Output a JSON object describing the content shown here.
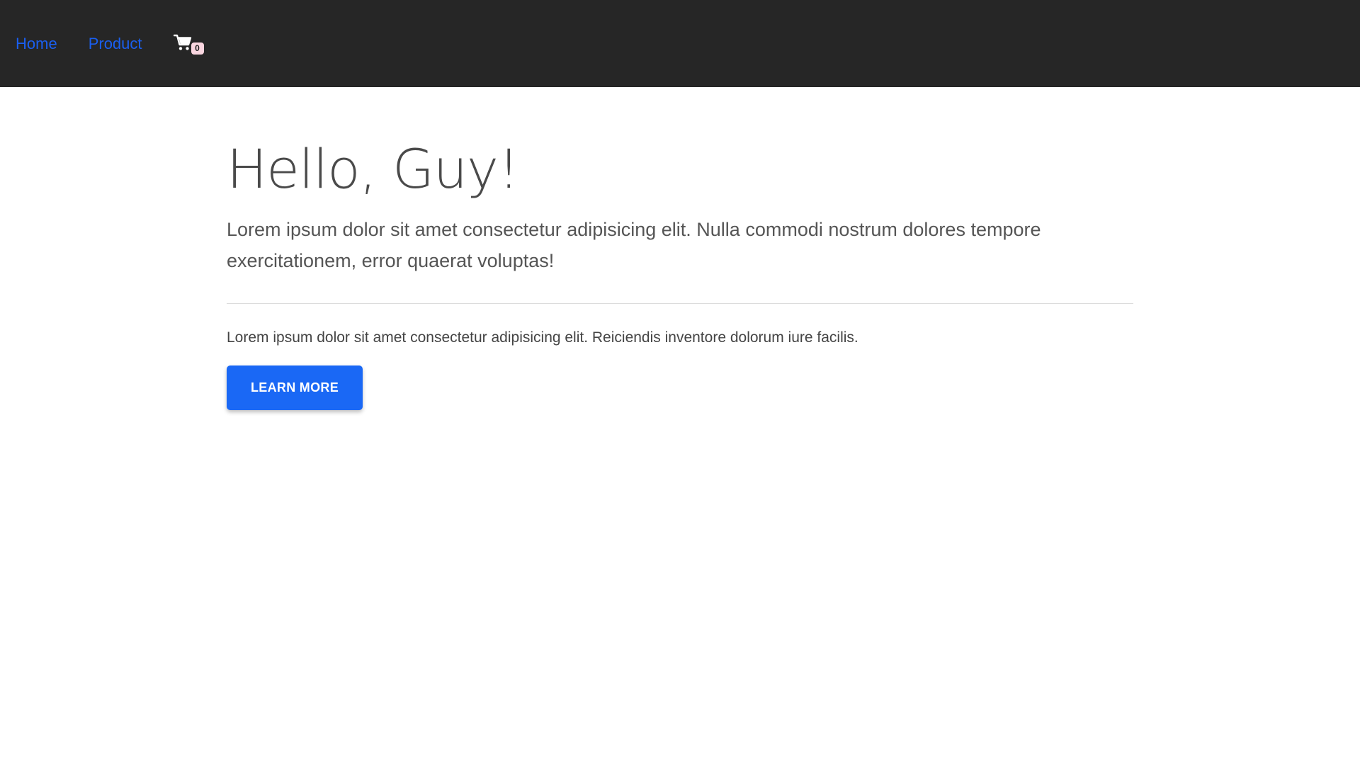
{
  "nav": {
    "links": [
      "Home",
      "Product"
    ],
    "cart_icon": "shopping-cart-icon",
    "cart_count": "0",
    "link_color": "#1a5ff0",
    "background": "#262626"
  },
  "jumbotron": {
    "title": "Hello, Guy!",
    "lead": "Lorem ipsum dolor sit amet consectetur adipisicing elit. Nulla commodi nostrum dolores tempore exercitationem, error quaerat voluptas!",
    "body": "Lorem ipsum dolor sit amet consectetur adipisicing elit. Reiciendis inventore dolorum iure facilis.",
    "button_label": "LEARN MORE",
    "button_color": "#1a68f5"
  }
}
